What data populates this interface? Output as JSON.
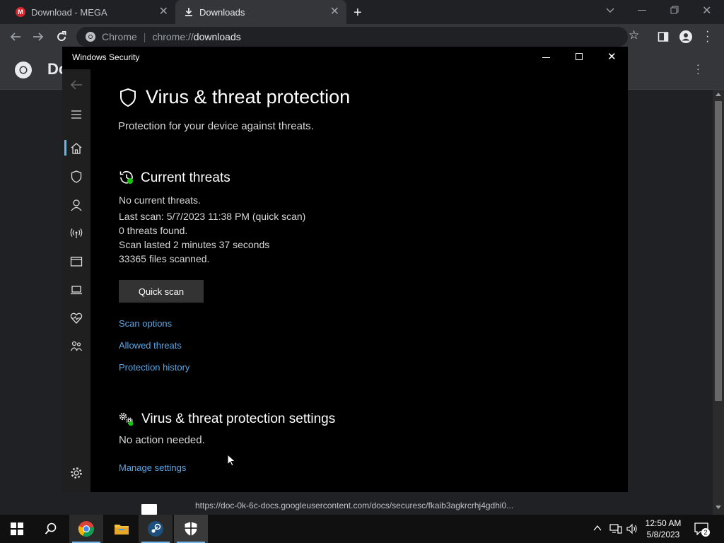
{
  "browser": {
    "tabs": [
      {
        "title": "Download - MEGA",
        "icon": "mega-logo"
      },
      {
        "title": "Downloads",
        "icon": "download-icon",
        "active": true
      }
    ],
    "omnibox": {
      "site_chip": "Chrome",
      "url_scheme": "chrome://",
      "url_host": "downloads"
    },
    "page_title_partial": "Do",
    "status_url": "https://doc-0k-6c-docs.googleusercontent.com/docs/securesc/fkaib3agkrcrhj4gdhi0..."
  },
  "security_window": {
    "title": "Windows Security",
    "page": {
      "heading": "Virus & threat protection",
      "subheading": "Protection for your device against threats.",
      "current_threats": {
        "heading": "Current threats",
        "lines": [
          "No current threats.",
          "Last scan: 5/7/2023 11:38 PM (quick scan)",
          "0 threats found.",
          "Scan lasted 2 minutes 37 seconds",
          "33365 files scanned."
        ],
        "quick_scan_label": "Quick scan",
        "links": [
          "Scan options",
          "Allowed threats",
          "Protection history"
        ]
      },
      "settings": {
        "heading": "Virus & threat protection settings",
        "status": "No action needed.",
        "link": "Manage settings"
      }
    }
  },
  "taskbar": {
    "time": "12:50 AM",
    "date": "5/8/2023",
    "notification_count": "2"
  },
  "colors": {
    "accent": "#4cc2ff",
    "link": "#5aa7e6",
    "chrome_dark": "#202124"
  }
}
